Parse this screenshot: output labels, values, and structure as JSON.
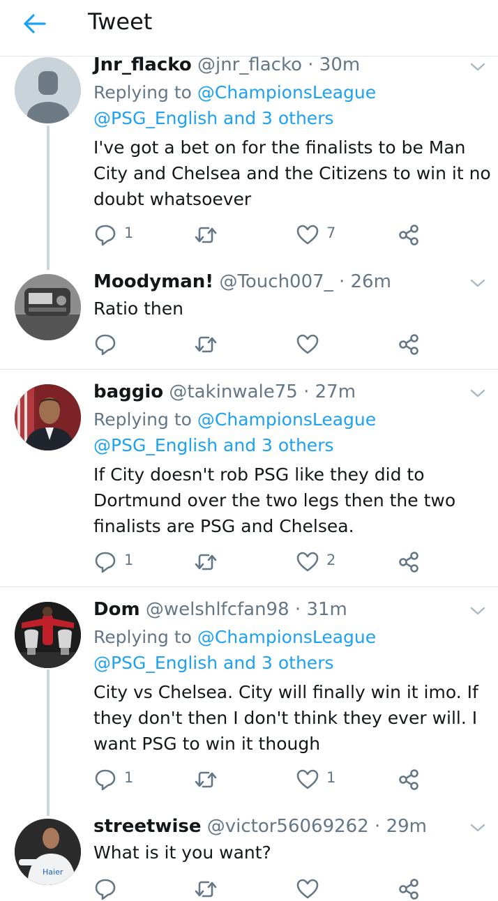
{
  "header": {
    "title": "Tweet"
  },
  "tweets": [
    {
      "name": "Jnr_flacko",
      "handle": "@jnr_flacko",
      "time": "· 30m",
      "replying_prefix": "Replying to ",
      "replying_to": "@ChampionsLeague",
      "replying_more": "@PSG_English and 3 others",
      "text": "I've got a bet on for the finalists to be Man City  and Chelsea and the Citizens  to win it no doubt whatsoever",
      "replies": "1",
      "retweets": "",
      "likes": "7"
    },
    {
      "name": "Moodyman!",
      "handle": "@Touch007_",
      "time": "· 26m",
      "text": "Ratio then",
      "replies": "",
      "retweets": "",
      "likes": ""
    },
    {
      "name": "baggio",
      "handle": "@takinwale75",
      "time": "· 27m",
      "replying_prefix": "Replying to ",
      "replying_to": "@ChampionsLeague",
      "replying_more": "@PSG_English and 3 others",
      "text": "If City doesn't rob PSG like they did to Dortmund over the two legs then the two finalists are PSG and Chelsea.",
      "replies": "1",
      "retweets": "",
      "likes": "2"
    },
    {
      "name": "Dom",
      "handle": "@welshlfcfan98",
      "time": "· 31m",
      "replying_prefix": "Replying to ",
      "replying_to": "@ChampionsLeague",
      "replying_more": "@PSG_English and 3 others",
      "text": "City vs Chelsea. City will finally win it imo. If they don't then I don't think they ever will. I want PSG to win it though",
      "replies": "1",
      "retweets": "",
      "likes": "1"
    },
    {
      "name": "streetwise",
      "handle": "@victor56069262",
      "time": "· 29m",
      "text": "What is it you want?"
    }
  ],
  "icons": {
    "back": "arrow-left-icon",
    "reply": "speech-bubble-icon",
    "retweet": "retweet-icon",
    "like": "heart-icon",
    "share": "share-icon",
    "caret": "chevron-down-icon"
  },
  "colors": {
    "accent": "#1da1f2",
    "secondary_text": "#657786",
    "divider": "#e1e8ed"
  }
}
